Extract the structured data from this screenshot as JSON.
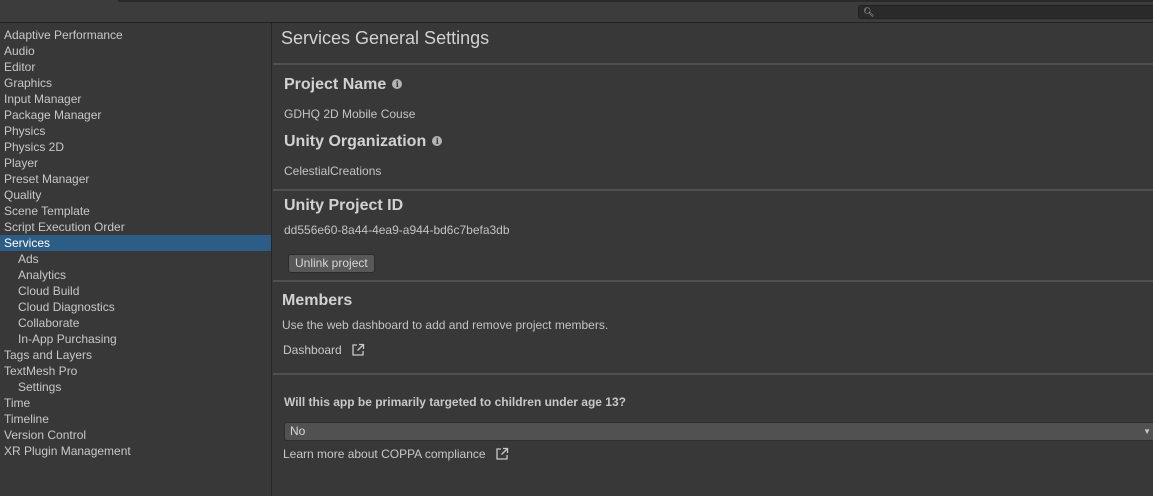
{
  "sidebar": {
    "items": [
      {
        "label": "Adaptive Performance",
        "level": 0,
        "selected": false
      },
      {
        "label": "Audio",
        "level": 0,
        "selected": false
      },
      {
        "label": "Editor",
        "level": 0,
        "selected": false
      },
      {
        "label": "Graphics",
        "level": 0,
        "selected": false
      },
      {
        "label": "Input Manager",
        "level": 0,
        "selected": false
      },
      {
        "label": "Package Manager",
        "level": 0,
        "selected": false
      },
      {
        "label": "Physics",
        "level": 0,
        "selected": false
      },
      {
        "label": "Physics 2D",
        "level": 0,
        "selected": false
      },
      {
        "label": "Player",
        "level": 0,
        "selected": false
      },
      {
        "label": "Preset Manager",
        "level": 0,
        "selected": false
      },
      {
        "label": "Quality",
        "level": 0,
        "selected": false
      },
      {
        "label": "Scene Template",
        "level": 0,
        "selected": false
      },
      {
        "label": "Script Execution Order",
        "level": 0,
        "selected": false
      },
      {
        "label": "Services",
        "level": 0,
        "selected": true
      },
      {
        "label": "Ads",
        "level": 1,
        "selected": false
      },
      {
        "label": "Analytics",
        "level": 1,
        "selected": false
      },
      {
        "label": "Cloud Build",
        "level": 1,
        "selected": false
      },
      {
        "label": "Cloud Diagnostics",
        "level": 1,
        "selected": false
      },
      {
        "label": "Collaborate",
        "level": 1,
        "selected": false
      },
      {
        "label": "In-App Purchasing",
        "level": 1,
        "selected": false
      },
      {
        "label": "Tags and Layers",
        "level": 0,
        "selected": false
      },
      {
        "label": "TextMesh Pro",
        "level": 0,
        "selected": false
      },
      {
        "label": "Settings",
        "level": 1,
        "selected": false
      },
      {
        "label": "Time",
        "level": 0,
        "selected": false
      },
      {
        "label": "Timeline",
        "level": 0,
        "selected": false
      },
      {
        "label": "Version Control",
        "level": 0,
        "selected": false
      },
      {
        "label": "XR Plugin Management",
        "level": 0,
        "selected": false
      }
    ]
  },
  "main": {
    "title": "Services General Settings",
    "project_name": {
      "heading": "Project Name",
      "value": "GDHQ 2D Mobile Couse"
    },
    "organization": {
      "heading": "Unity Organization",
      "value": "CelestialCreations"
    },
    "project_id": {
      "heading": "Unity Project ID",
      "value": "dd556e60-8a44-4ea9-a944-bd6c7befa3db"
    },
    "unlink_button": "Unlink project",
    "members": {
      "heading": "Members",
      "description": "Use the web dashboard to add and remove project members.",
      "dashboard_link": "Dashboard"
    },
    "coppa": {
      "question": "Will this app be primarily targeted to children under age 13?",
      "selected": "No",
      "learn_more": "Learn more about COPPA compliance"
    }
  },
  "icons": {
    "search": "search-icon",
    "info": "info-icon",
    "external_link": "external-link-icon",
    "dropdown": "dropdown-arrow-icon"
  },
  "colors": {
    "background": "#383838",
    "selection": "#2c5d87",
    "divider": "#505050"
  }
}
